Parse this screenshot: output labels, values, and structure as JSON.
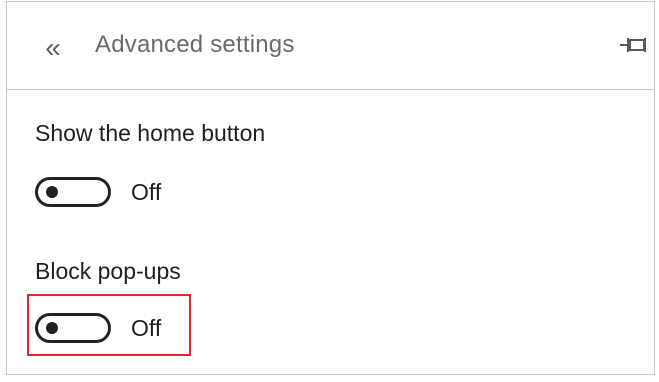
{
  "header": {
    "back_icon": "double-chevron-left-icon",
    "back_glyph": "«",
    "title": "Advanced settings",
    "pin_icon": "pin-icon"
  },
  "settings": [
    {
      "label": "Show the home button",
      "state": "Off"
    },
    {
      "label": "Block pop-ups",
      "state": "Off"
    }
  ],
  "colors": {
    "highlight": "#e0292f",
    "toggle": "#222222"
  }
}
